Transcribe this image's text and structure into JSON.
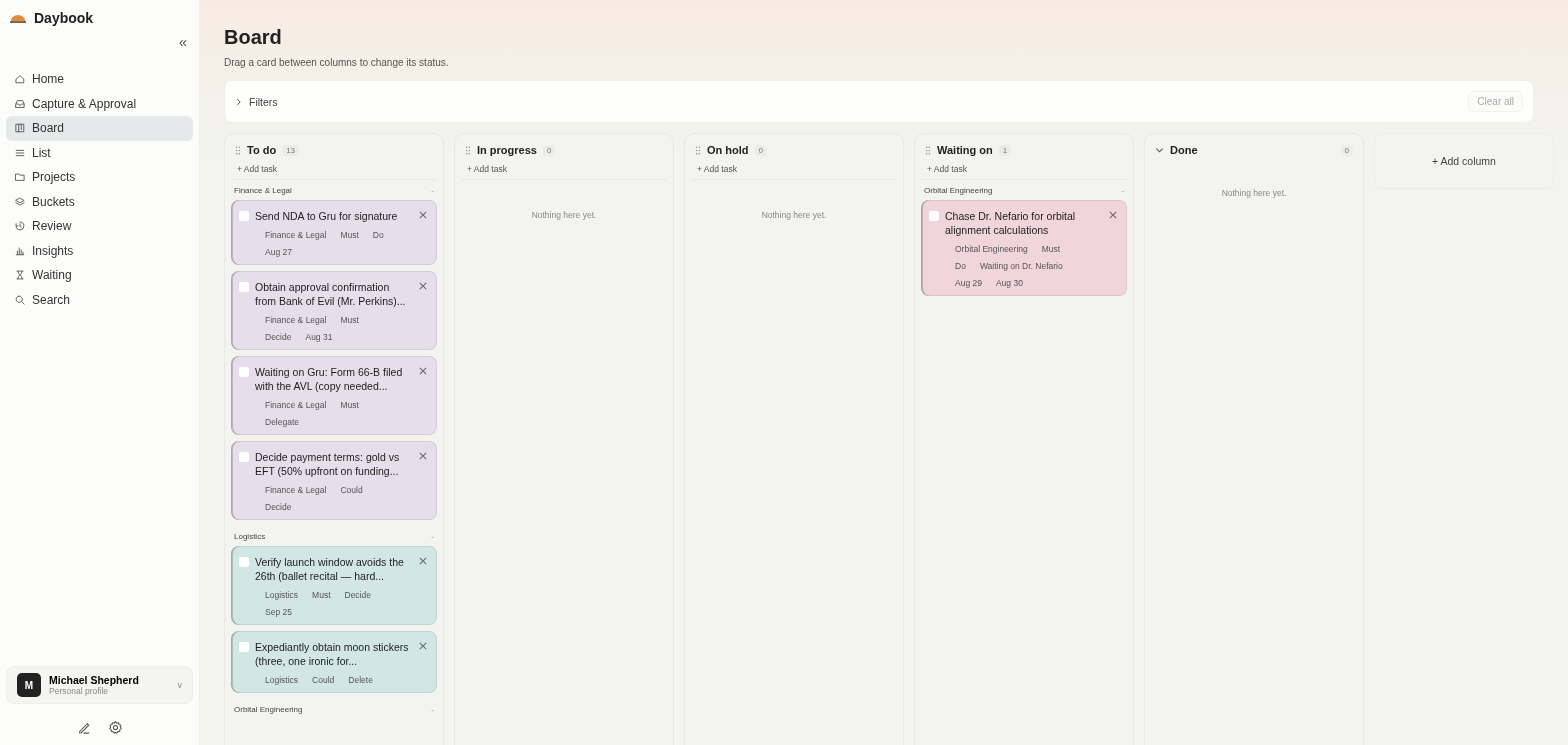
{
  "app": {
    "name": "Daybook",
    "collapse": "«"
  },
  "nav": [
    {
      "label": "Home",
      "selected": false
    },
    {
      "label": "Capture & Approval",
      "selected": false
    },
    {
      "label": "Board",
      "selected": true
    },
    {
      "label": "List",
      "selected": false
    },
    {
      "label": "Projects",
      "selected": false
    },
    {
      "label": "Buckets",
      "selected": false
    },
    {
      "label": "Review",
      "selected": false
    },
    {
      "label": "Insights",
      "selected": false
    },
    {
      "label": "Waiting",
      "selected": false
    },
    {
      "label": "Search",
      "selected": false
    }
  ],
  "profile": {
    "initial": "M",
    "name": "Michael Shepherd",
    "subtitle": "Personal profile",
    "caret": "v"
  },
  "page": {
    "title": "Board",
    "subtitle": "Drag a card between columns to change its status."
  },
  "filters": {
    "label": "Filters",
    "expanded": false,
    "clear": "Clear all"
  },
  "columns": [
    {
      "title": "To do",
      "count": "13",
      "kind": "list",
      "add": "+ Add task",
      "groups": [
        {
          "name": "Finance & Legal",
          "toggle": "-",
          "cards": [
            {
              "title": "Send NDA to Gru for signature",
              "color": "#e6dfeb",
              "checked": false,
              "meta": [
                [
                  "Finance & Legal",
                  "Must",
                  "Do"
                ],
                [
                  "Aug 27"
                ]
              ]
            },
            {
              "title": "Obtain approval confirmation from Bank of Evil (Mr. Perkins)...",
              "color": "#e6dfeb",
              "checked": false,
              "meta": [
                [
                  "Finance & Legal",
                  "Must"
                ],
                [
                  "Decide",
                  "Aug 31"
                ]
              ]
            },
            {
              "title": "Waiting on Gru: Form 66-B filed with the AVL (copy needed...",
              "color": "#e6dfeb",
              "checked": false,
              "meta": [
                [
                  "Finance & Legal",
                  "Must"
                ],
                [
                  "Delegate"
                ]
              ]
            },
            {
              "title": "Decide payment terms: gold vs EFT (50% upfront on funding...",
              "color": "#e6dfeb",
              "checked": false,
              "meta": [
                [
                  "Finance & Legal",
                  "Could"
                ],
                [
                  "Decide"
                ]
              ]
            }
          ]
        },
        {
          "name": "Logistics",
          "toggle": "-",
          "cards": [
            {
              "title": "Verify launch window avoids the 26th (ballet recital — hard...",
              "color": "#d2e7e5",
              "checked": false,
              "meta": [
                [
                  "Logistics",
                  "Must",
                  "Decide"
                ],
                [
                  "Sep 25"
                ]
              ]
            },
            {
              "title": "Expediantly obtain moon stickers (three, one ironic for...",
              "color": "#d2e7e5",
              "checked": false,
              "meta": [
                [
                  "Logistics",
                  "Could",
                  "Delete"
                ]
              ]
            }
          ]
        },
        {
          "name": "Orbital Engineering",
          "toggle": "-"
        }
      ]
    },
    {
      "title": "In progress",
      "count": "0",
      "kind": "list",
      "add": "+ Add task",
      "empty": "Nothing here yet."
    },
    {
      "title": "On hold",
      "count": "0",
      "kind": "list",
      "add": "+ Add task",
      "empty": "Nothing here yet."
    },
    {
      "title": "Waiting on",
      "count": "1",
      "kind": "list",
      "add": "+ Add task",
      "groups": [
        {
          "name": "Orbital Engineering",
          "toggle": "-",
          "cards": [
            {
              "title": "Chase Dr. Nefario for orbital alignment calculations",
              "color": "#f0d5dc",
              "checked": false,
              "meta": [
                [
                  "Orbital Engineering",
                  "Must"
                ],
                [
                  "Do",
                  "Waiting on Dr. Nefario"
                ],
                [
                  "Aug 29",
                  "Aug 30"
                ]
              ]
            }
          ]
        }
      ]
    },
    {
      "title": "Done",
      "count": "0",
      "kind": "done",
      "expanded": true,
      "empty": "Nothing here yet."
    }
  ],
  "add_column": "+ Add column"
}
